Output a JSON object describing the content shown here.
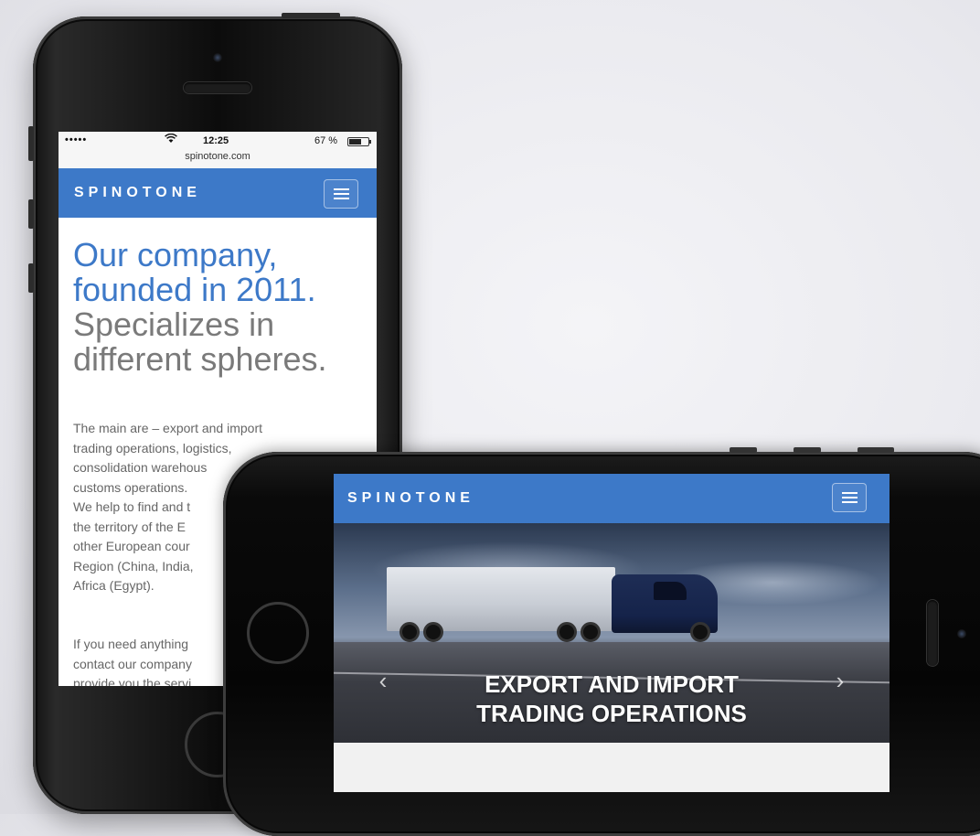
{
  "portrait": {
    "status": {
      "signal": "•••••",
      "time": "12:25",
      "battery": "67 %",
      "url": "spinotone.com"
    },
    "brand": "SPINOTONE",
    "heading": {
      "line1": "Our company,",
      "line2": "founded in 2011.",
      "line3": "Specializes in",
      "line4": "different spheres."
    },
    "body_lines": [
      "The main are – export and import",
      "trading operations, logistics,",
      "consolidation warehous",
      "customs operations.",
      "We help to find and t",
      "the territory of the E",
      "other European cour",
      "Region (China, India,",
      "Africa (Egypt)."
    ],
    "body2_lines": [
      "If you need anything",
      "contact our company",
      "provide you the servi"
    ]
  },
  "landscape": {
    "brand": "SPINOTONE",
    "hero_line1": "EXPORT AND IMPORT",
    "hero_line2": "TRADING OPERATIONS",
    "prev": "‹",
    "next": "›"
  },
  "colors": {
    "brand_blue": "#3d79c8",
    "heading_gray": "#7a7a7a"
  },
  "icons": [
    "wifi-icon",
    "battery-icon",
    "menu-icon",
    "chevron-left-icon",
    "chevron-right-icon"
  ]
}
